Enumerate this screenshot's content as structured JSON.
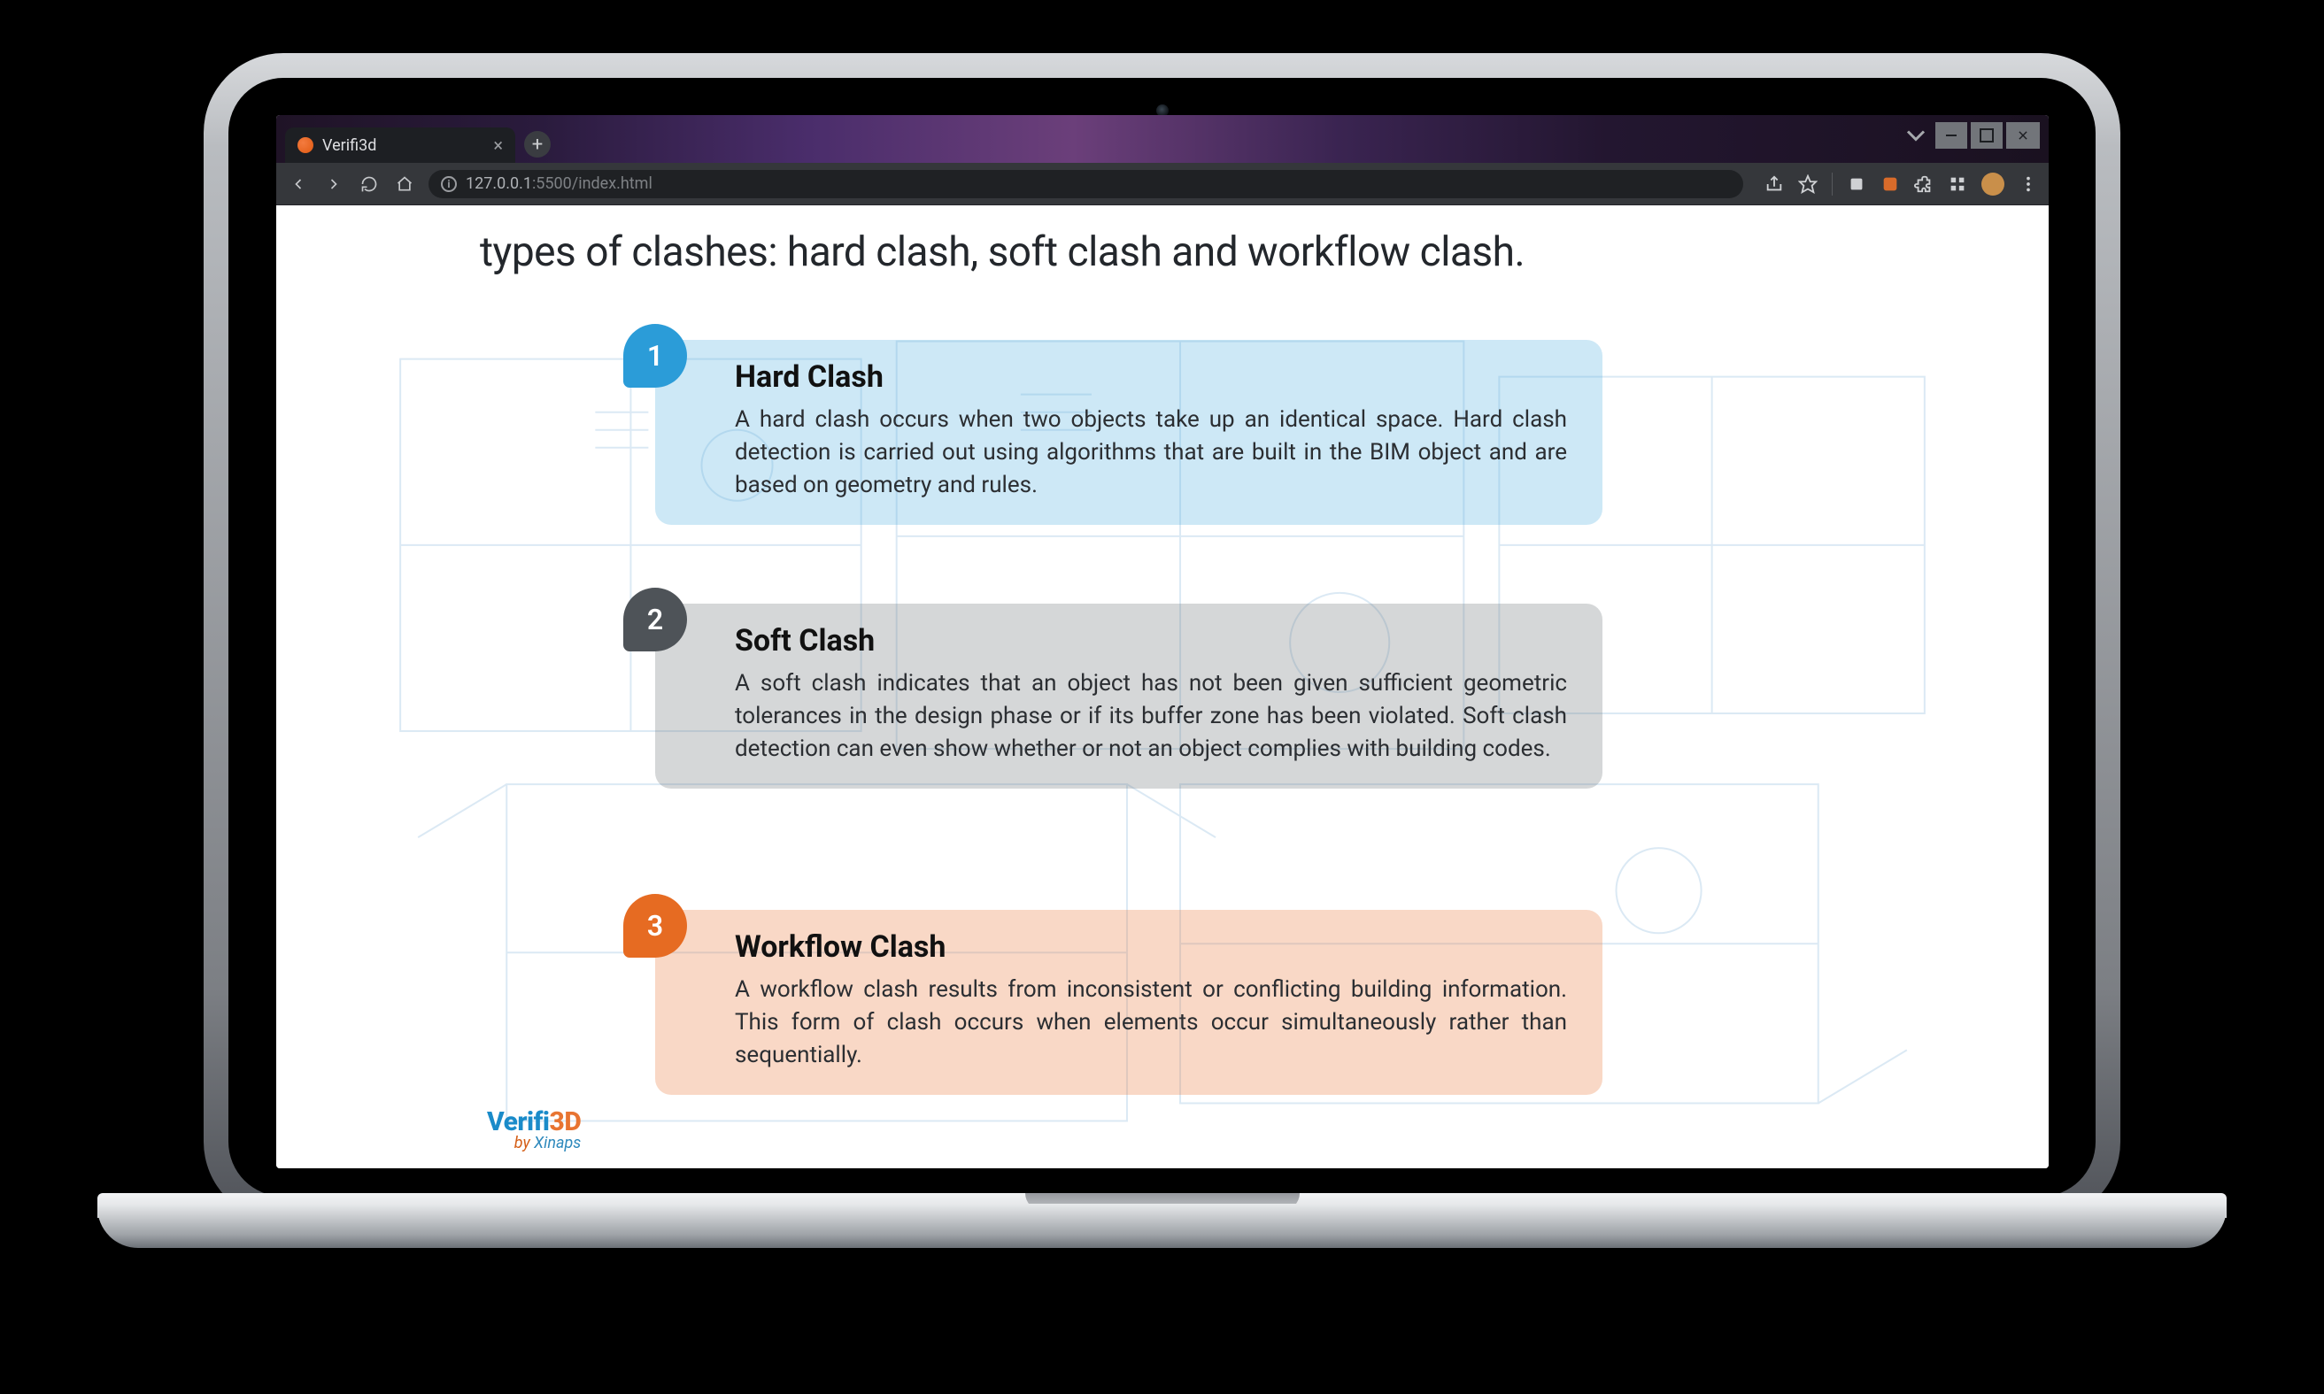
{
  "browser": {
    "tab_title": "Verifi3d",
    "url_host": "127.0.0.1",
    "url_port_path": ":5500/index.html"
  },
  "page": {
    "heading_fragment": "types of clashes: hard clash, soft clash and workflow clash.",
    "cards": [
      {
        "num": "1",
        "title": "Hard Clash",
        "body": "A hard clash occurs when two objects take up an identical space. Hard clash detection is carried out using algorithms that are built in the BIM object and are based on geometry and rules."
      },
      {
        "num": "2",
        "title": "Soft Clash",
        "body": "A soft clash indicates that an object has not been given sufficient geometric tolerances in the design phase or if its buffer zone has been violated. Soft clash detection can even show whether or not an object complies with building codes."
      },
      {
        "num": "3",
        "title": "Workflow Clash",
        "body": "A workflow clash results from inconsistent or conflicting building information. This form of clash occurs when elements occur simultaneously rather than sequentially."
      }
    ],
    "logo": {
      "part1": "Verifi",
      "part2": "3D",
      "byline_by": "by ",
      "byline_name": "Xinaps"
    }
  }
}
